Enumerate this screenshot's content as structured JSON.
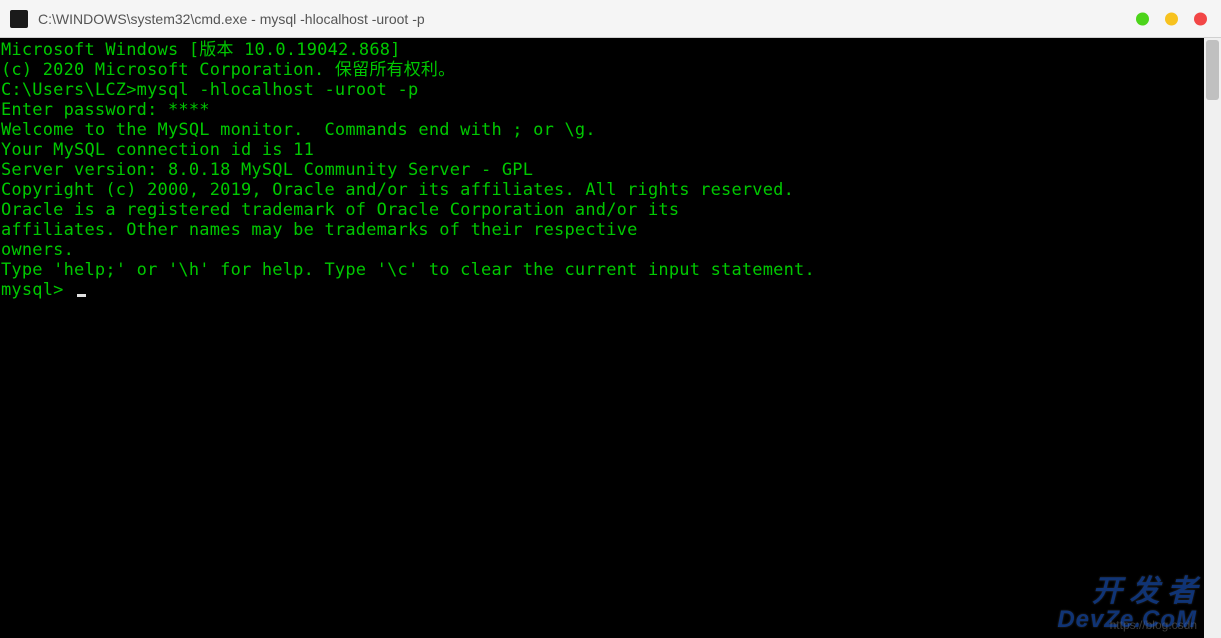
{
  "titlebar": {
    "title": "C:\\WINDOWS\\system32\\cmd.exe - mysql  -hlocalhost -uroot -p"
  },
  "terminal": {
    "lines": [
      "Microsoft Windows [版本 10.0.19042.868]",
      "(c) 2020 Microsoft Corporation. 保留所有权利。",
      "",
      "C:\\Users\\LCZ>mysql -hlocalhost -uroot -p",
      "Enter password: ****",
      "Welcome to the MySQL monitor.  Commands end with ; or \\g.",
      "Your MySQL connection id is 11",
      "Server version: 8.0.18 MySQL Community Server - GPL",
      "",
      "Copyright (c) 2000, 2019, Oracle and/or its affiliates. All rights reserved.",
      "",
      "Oracle is a registered trademark of Oracle Corporation and/or its",
      "affiliates. Other names may be trademarks of their respective",
      "owners.",
      "",
      "Type 'help;' or '\\h' for help. Type '\\c' to clear the current input statement.",
      ""
    ],
    "prompt": "mysql> "
  },
  "watermark": {
    "line1": "开 发 者",
    "line2": "DevZe.CoM",
    "url": "https://blog.csdn"
  }
}
